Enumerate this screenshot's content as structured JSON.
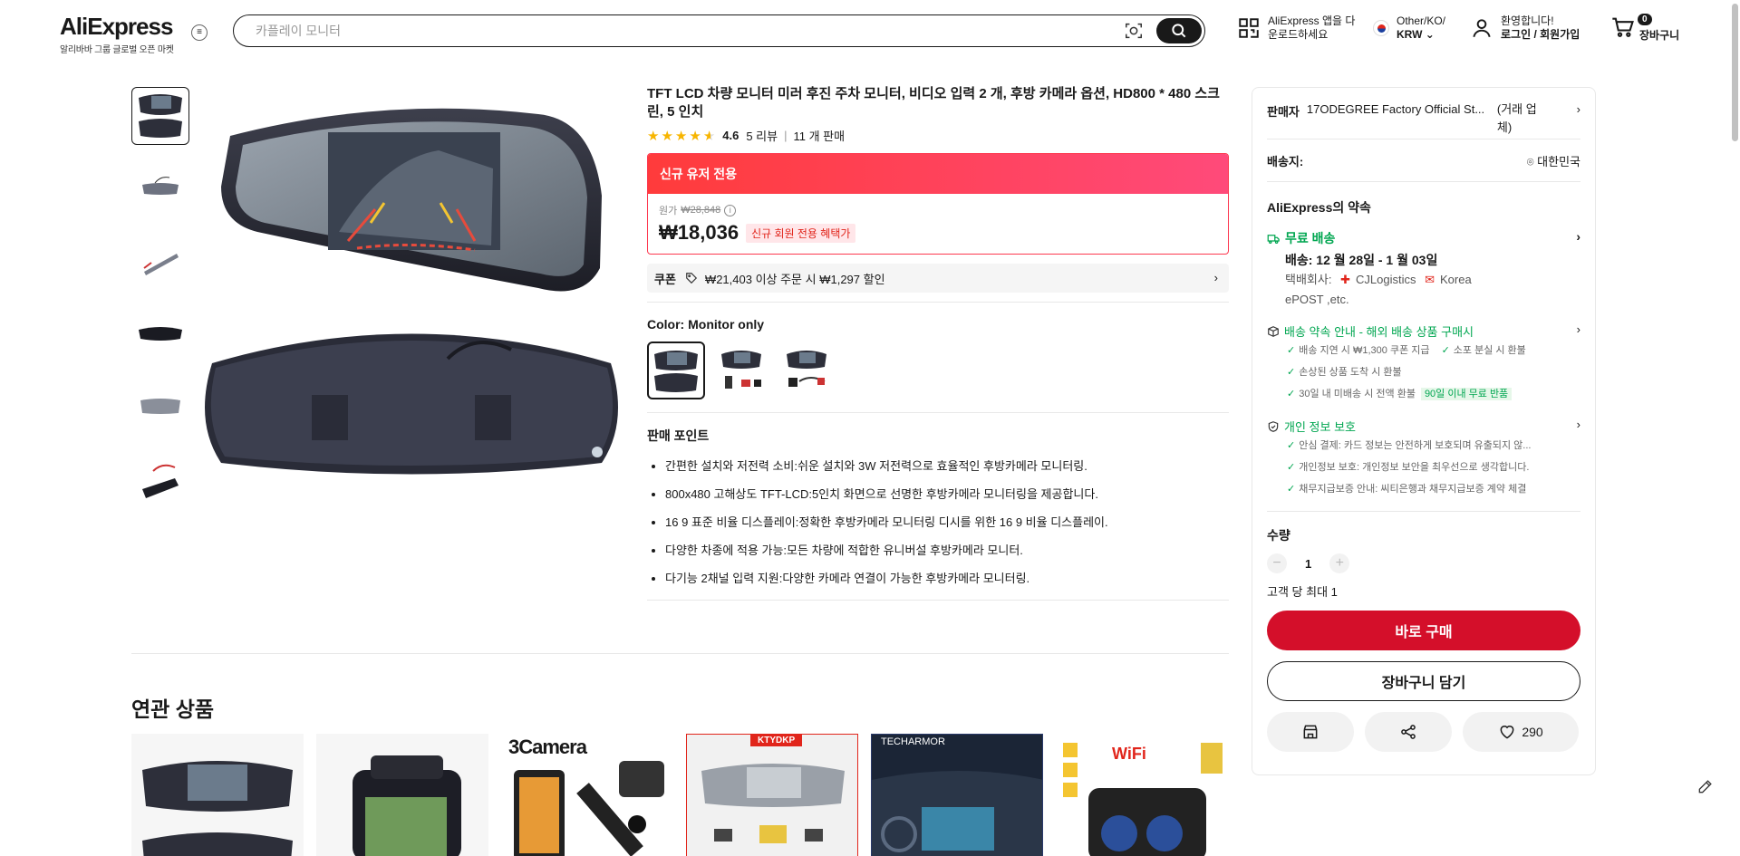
{
  "header": {
    "logo": "AliExpress",
    "logo_sub": "알리바바 그룹 글로벌 오픈 마켓",
    "search_placeholder": "카플레이 모니터",
    "app_line1": "AliExpress 앱을 다",
    "app_line2": "운로드하세요",
    "locale_line1": "Other/KO/",
    "locale_line2": "KRW",
    "welcome": "환영합니다!",
    "login": "로그인 / 회원가입",
    "cart_count": "0",
    "cart_label": "장바구니"
  },
  "product": {
    "title": "TFT LCD 차량 모니터 미러 후진 주차 모니터, 비디오 입력 2 개, 후방 카메라 옵션, HD800 * 480 스크린, 5 인치",
    "rating": "4.6",
    "reviews": "5 리뷰",
    "sold": "11 개 판매",
    "rating_value": 4.6
  },
  "promo": {
    "header": "신규 유저 전용",
    "orig_label": "원가",
    "orig_price": "₩28,848",
    "price": "₩18,036",
    "tag": "신규 회원 전용 혜택가"
  },
  "coupon": {
    "label": "쿠폰",
    "text": "₩21,403 이상 주문 시 ₩1,297 할인"
  },
  "color": {
    "label": "Color: Monitor only"
  },
  "points": {
    "title": "판매 포인트",
    "items": [
      "간편한 설치와 저전력 소비:쉬운 설치와 3W 저전력으로 효율적인 후방카메라 모니터링.",
      "800x480 고해상도 TFT-LCD:5인치 화면으로 선명한 후방카메라 모니터링을 제공합니다.",
      "16 9 표준 비율 디스플레이:정확한 후방카메라 모니터링 디시를 위한 16 9 비율 디스플레이.",
      "다양한 차종에 적용 가능:모든 차량에 적합한 유니버설 후방카메라 모니터.",
      "다기능 2채널 입력 지원:다양한 카메라 연결이 가능한 후방카메라 모니터링."
    ]
  },
  "panel": {
    "seller_label": "판매자",
    "seller_name": "17ODEGREE Factory Official St...",
    "seller_type": "(거래 업체)",
    "ship_label": "배송지:",
    "ship_to": "대한민국",
    "promise_title": "AliExpress의 약속",
    "free_ship": "무료 배송",
    "delivery": "배송: 12 월 28일 - 1 월 03일",
    "carrier_prefix": "택배회사:",
    "carrier1": "CJLogistics",
    "carrier2": "Korea",
    "carrier3": "ePOST ,etc.",
    "promise2": "배송 약속 안내 - 해외 배송 상품 구매시",
    "c1": "배송 지연 시 ₩1,300 쿠폰 지급",
    "c2": "소포 분실 시 환불",
    "c3": "손상된 상품 도착 시 환불",
    "c4": "30일 내 미배송 시 전액 환불",
    "c4_tag": "90일 이내 무료 반품",
    "privacy": "개인 정보 보호",
    "p1": "안심 결제: 카드 정보는 안전하게 보호되며 유출되지 않...",
    "p2": "개인정보 보호: 개인정보 보안을 최우선으로 생각합니다.",
    "p3": "채무지급보증 안내: 씨티은행과 채무지급보증 계약 체결",
    "qty_label": "수량",
    "qty": "1",
    "limit": "고객 당 최대 1",
    "buy": "바로 구매",
    "add_cart": "장바구니 담기",
    "wish_count": "290"
  },
  "related": {
    "title": "연관 상품",
    "card3_text": "3Camera",
    "card4_text": "KTYDKP",
    "card5_text": "TECHARMOR",
    "card6_text": "WiFi"
  },
  "colors": {
    "accent_red": "#d40f2a",
    "green": "#00a650",
    "star": "#f7b500"
  }
}
